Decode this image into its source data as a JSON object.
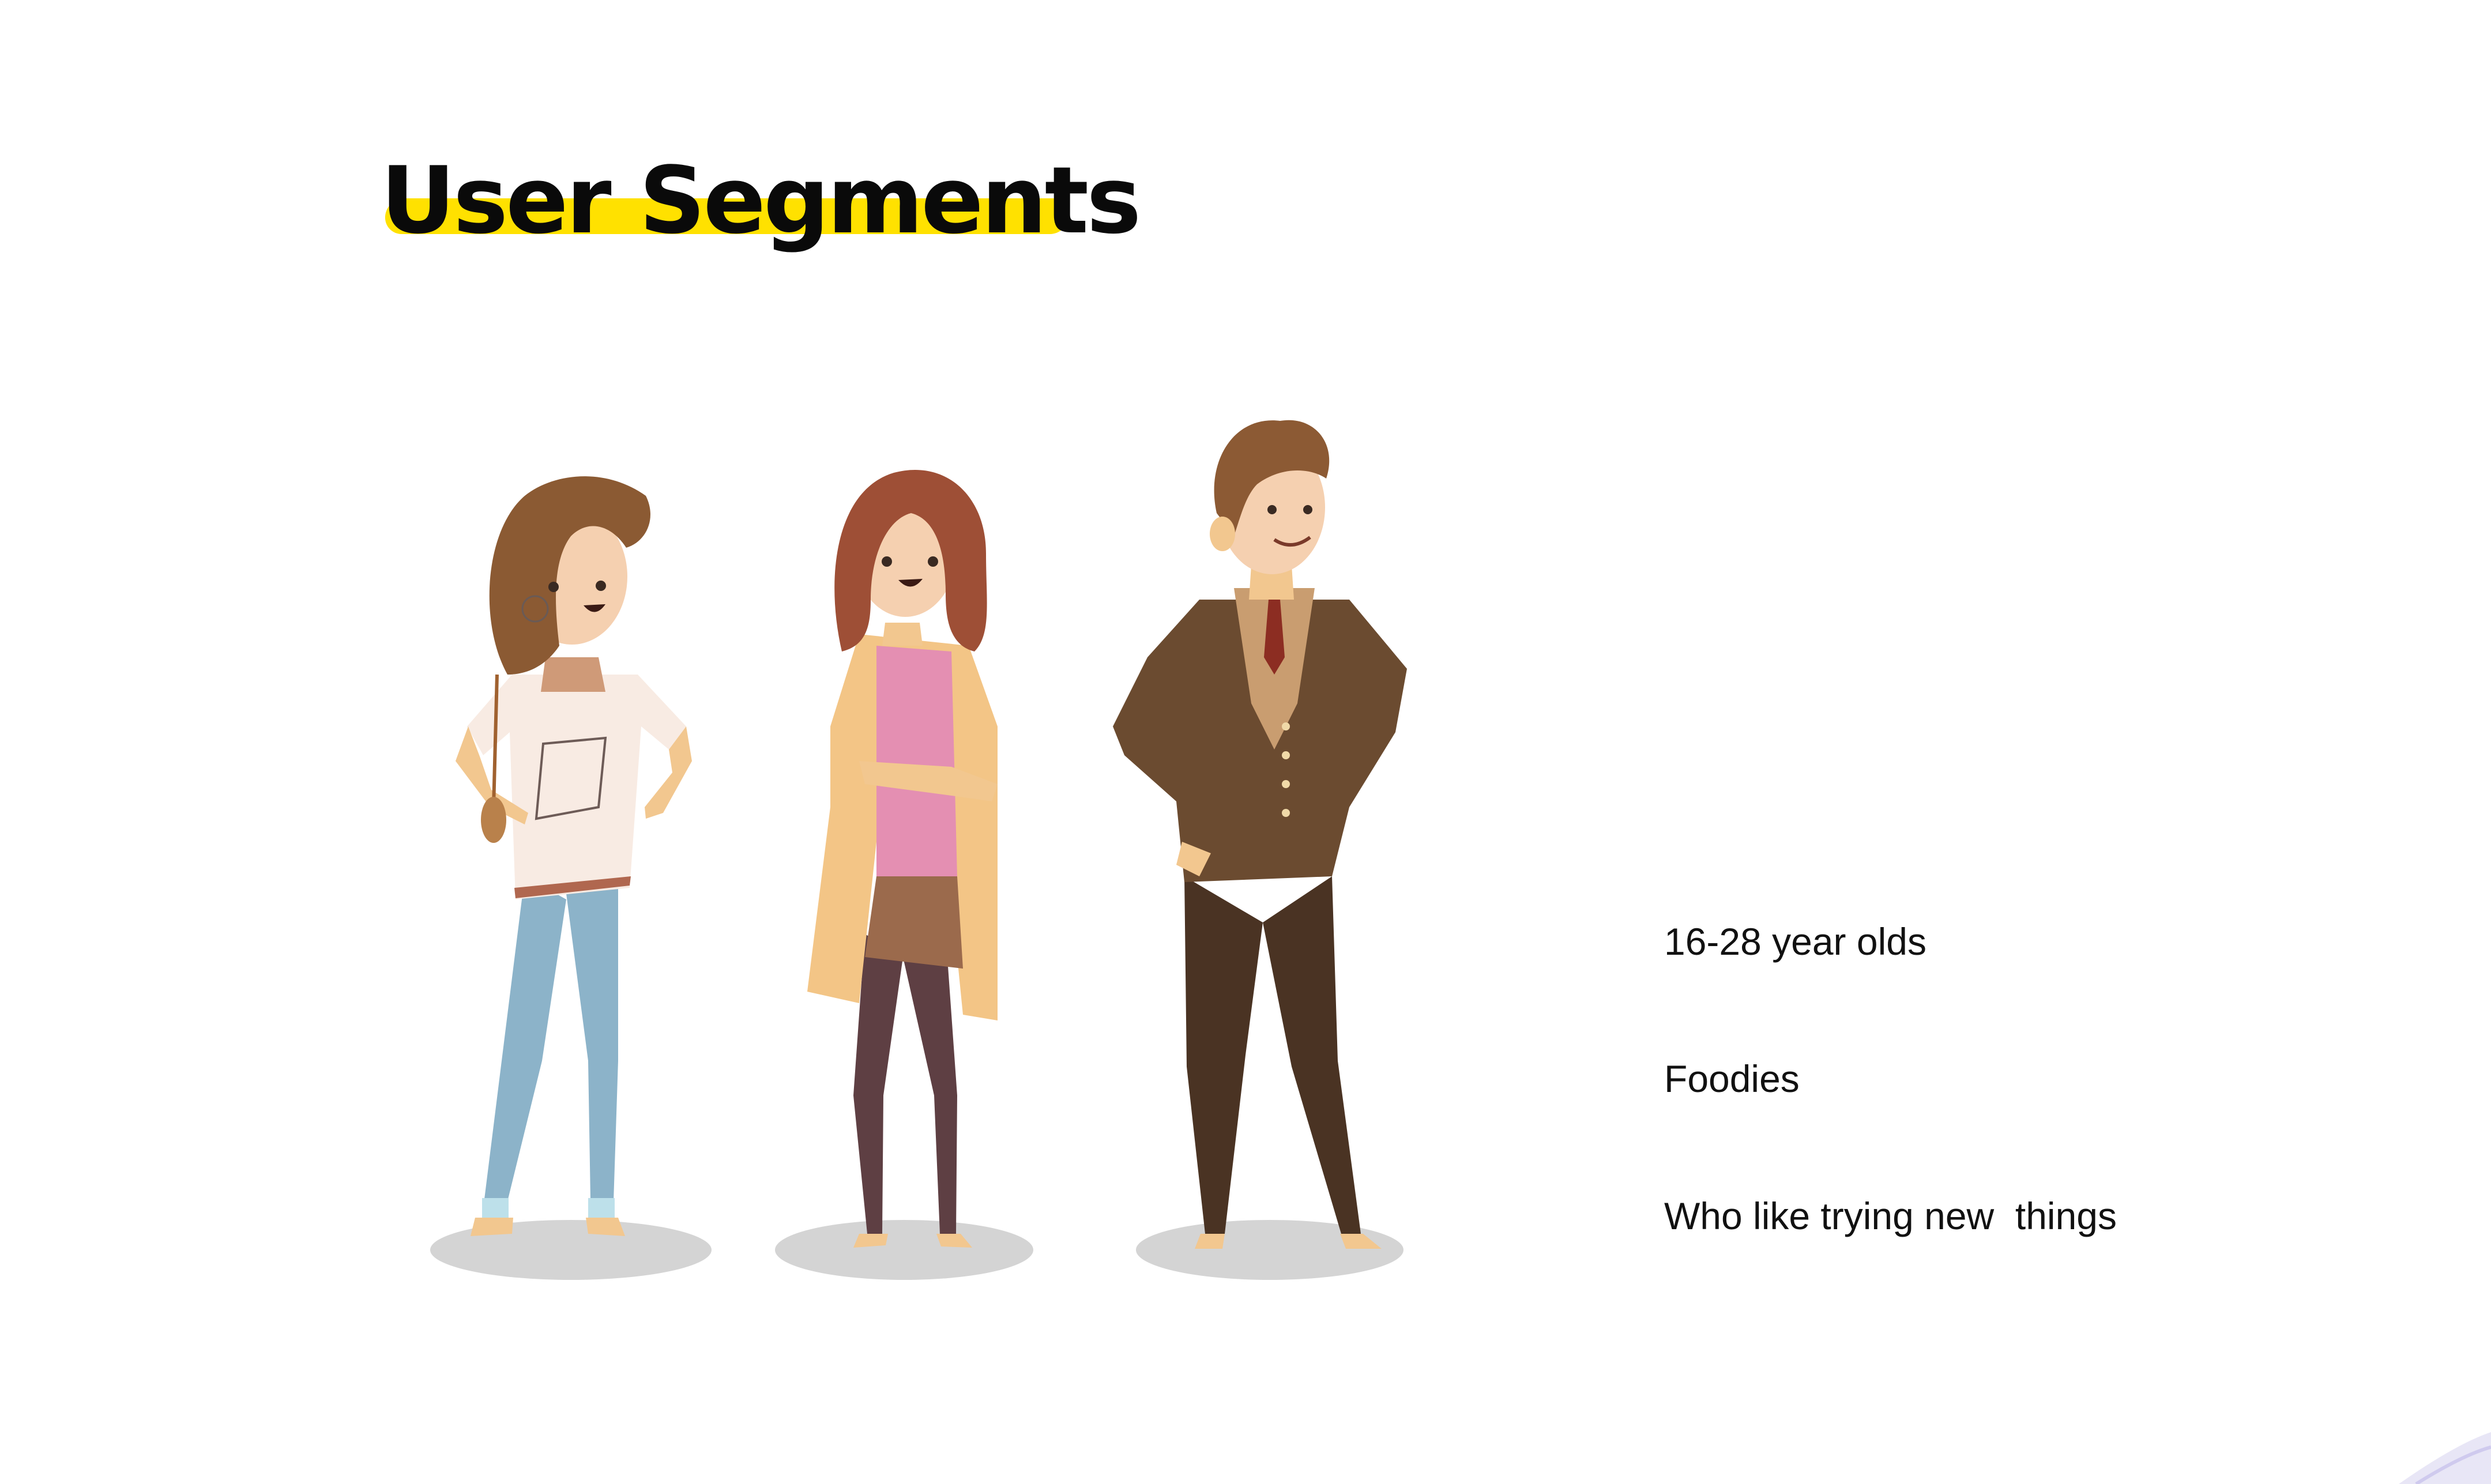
{
  "slide": {
    "title": "User Segments",
    "accent_color": "#ffe100",
    "points": [
      "16-28 year olds",
      "Foodies",
      "Who like trying new  things"
    ]
  },
  "illustration": {
    "figures": [
      "woman-casual-icon",
      "woman-cardigan-icon",
      "man-suit-icon"
    ]
  }
}
